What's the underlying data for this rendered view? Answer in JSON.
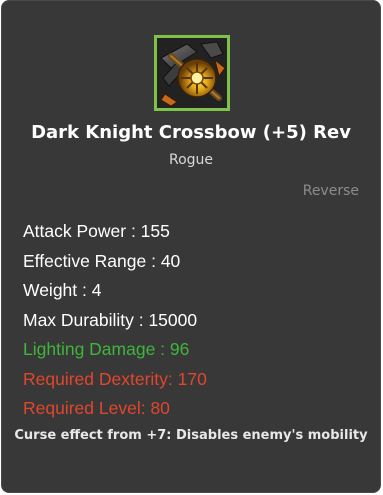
{
  "item": {
    "name": "Dark Knight Crossbow (+5) Rev",
    "class": "Rogue",
    "reverse_label": "Reverse",
    "icon": "crossbow-icon",
    "frame_color": "#7ec24a"
  },
  "stats": [
    {
      "text": "Attack Power : 155",
      "color": "#ffffff"
    },
    {
      "text": "Effective Range : 40",
      "color": "#ffffff"
    },
    {
      "text": "Weight : 4",
      "color": "#ffffff"
    },
    {
      "text": "Max Durability : 15000",
      "color": "#ffffff"
    },
    {
      "text": "Lighting Damage : 96",
      "color": "#3fb53c"
    },
    {
      "text": "Required Dexterity: 170",
      "color": "#e2462d"
    },
    {
      "text": "Required Level: 80",
      "color": "#e2462d"
    }
  ],
  "curse_effect": "Curse effect from +7: Disables enemy's mobility",
  "colors": {
    "background": "#383838",
    "bonus_stat": "#3fb53c",
    "requirement": "#e2462d",
    "muted": "#8c8c8c"
  }
}
